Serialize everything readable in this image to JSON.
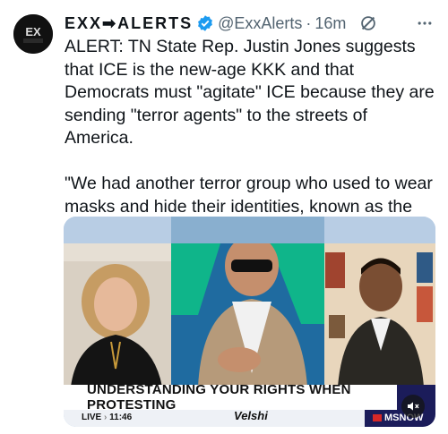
{
  "tweet": {
    "display_name": "EXX➡ALERTS",
    "handle": "@ExxAlerts",
    "separator": "·",
    "timestamp": "16m",
    "body": "ALERT: TN State Rep. Justin Jones suggests that ICE is the new-age KKK and that Democrats must \"agitate\" ICE because they are sending \"terror agents\" to the streets of America.\n\n\"We had another terror group who used to wear masks and hide their identities, known as the KKK.\""
  },
  "video": {
    "chyron": "UNDERSTANDING YOUR RIGHTS WHEN PROTESTING",
    "live_label": "LIVE",
    "clock": "11:46",
    "show_name": "Velshi",
    "network": "MSNOW"
  },
  "colors": {
    "verified": "#1d9bf0",
    "chyron_accent": "#2451c7",
    "network_bar": "#1b1c5a"
  },
  "icons": [
    "verified-badge-icon",
    "grok-icon",
    "more-icon",
    "mute-icon"
  ]
}
